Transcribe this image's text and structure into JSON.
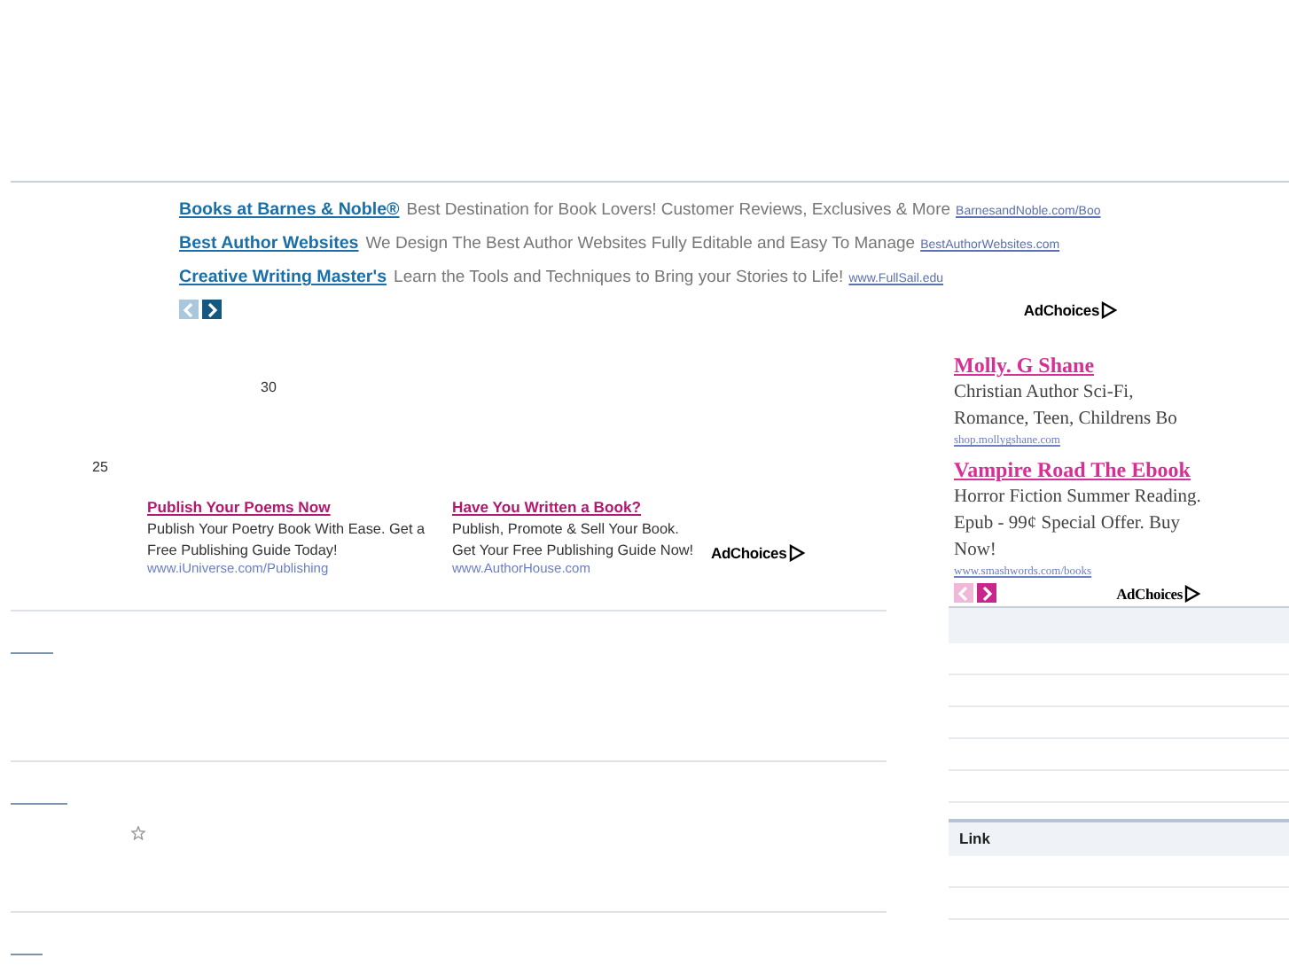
{
  "top_ads": {
    "items": [
      {
        "title": "Books at Barnes & Noble®",
        "text": "Best Destination for Book Lovers! Customer Reviews, Exclusives & More",
        "url": "BarnesandNoble.com/Boo"
      },
      {
        "title": "Best Author Websites",
        "text": "We Design The Best Author Websites Fully Editable and Easy To Manage",
        "url": "BestAuthorWebsites.com"
      },
      {
        "title": "Creative Writing Master's",
        "text": "Learn the Tools and Techniques to Bring your Stories to Life!",
        "url": "www.FullSail.edu"
      }
    ],
    "adchoices": "AdChoices"
  },
  "numbers": [
    "30",
    "25"
  ],
  "inline_ads": {
    "items": [
      {
        "title": "Publish Your Poems Now",
        "text": "Publish Your Poetry Book With Ease. Get a Free Publishing Guide Today!",
        "url": "www.iUniverse.com/Publishing"
      },
      {
        "title": "Have You Written a Book?",
        "text": "Publish, Promote & Sell Your Book. Get Your Free Publishing Guide Now!",
        "url": "www.AuthorHouse.com"
      }
    ],
    "adchoices": "AdChoices"
  },
  "entries": [
    {
      "starred": false
    },
    {
      "starred": true
    },
    {
      "starred": false
    }
  ],
  "side_ad": {
    "items": [
      {
        "title": "Molly. G Shane",
        "text": "Christian Author Sci-Fi, Romance, Teen, Childrens Bo",
        "url": "shop.mollygshane.com"
      },
      {
        "title": "Vampire Road The Ebook",
        "text": "Horror Fiction Summer Reading. Epub - 99¢ Special Offer. Buy Now!",
        "url": "www.smashwords.com/books"
      }
    ],
    "adchoices": "AdChoices"
  },
  "sidebar": {
    "header": "Link"
  }
}
